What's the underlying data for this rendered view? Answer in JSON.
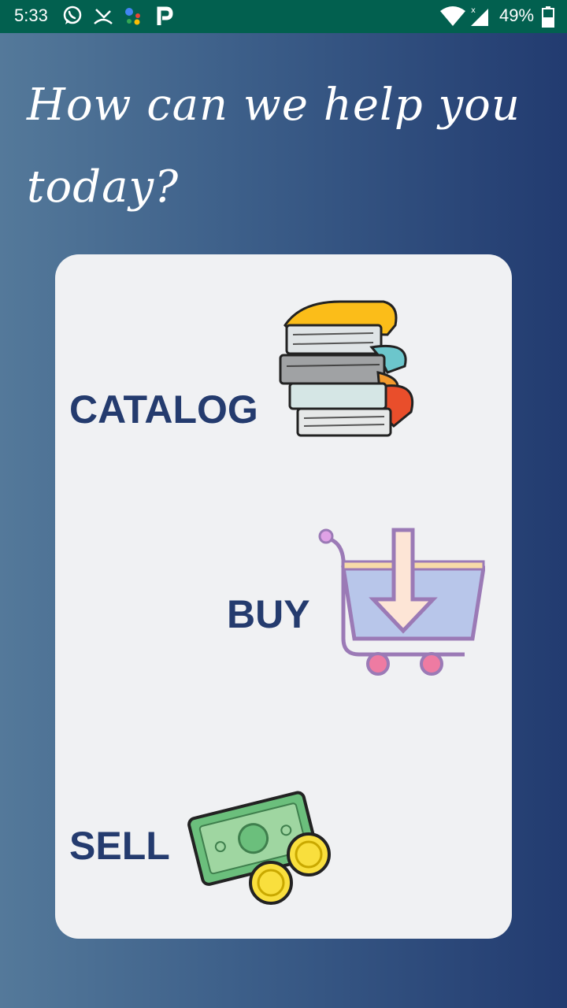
{
  "status_bar": {
    "time": "5:33",
    "battery": "49%",
    "icons": [
      "whatsapp-icon",
      "missed-call-icon",
      "assistant-icon",
      "paytm-icon",
      "wifi-icon",
      "signal-icon",
      "battery-icon"
    ]
  },
  "heading": {
    "line1": "How can we help you",
    "line2": "today?"
  },
  "options": {
    "catalog": {
      "label": "CATALOG",
      "icon": "books-icon"
    },
    "buy": {
      "label": "BUY",
      "icon": "shopping-cart-icon"
    },
    "sell": {
      "label": "SELL",
      "icon": "money-icon"
    }
  },
  "colors": {
    "status_bar": "#02604f",
    "label": "#243b6e",
    "card": "#f0f1f3"
  }
}
